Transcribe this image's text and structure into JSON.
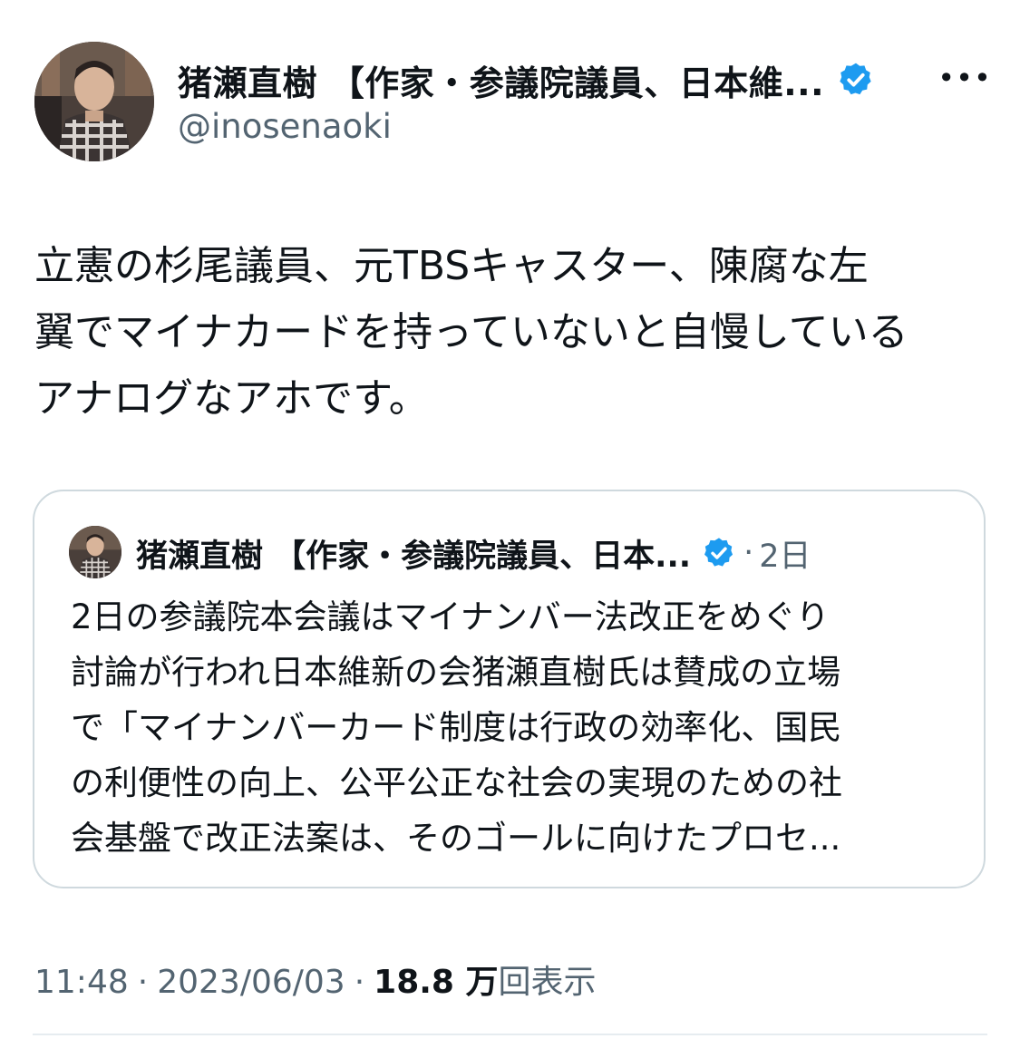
{
  "author": {
    "name": "猪瀬直樹 【作家・参議院議員、日本維...",
    "handle": "@inosenaoki",
    "verified_icon": "verified-badge-icon",
    "verified_color": "#1d9bf0"
  },
  "more_icon": "more-options-icon",
  "more_label": "•••",
  "tweet": {
    "text": "立憲の杉尾議員、元TBSキャスター、陳腐な左\n翼でマイナカードを持っていないと自慢している\nアナログなアホです。"
  },
  "quote": {
    "name": "猪瀬直樹 【作家・参議院議員、日本...",
    "dot": "·",
    "time": "2日",
    "text": "2日の参議院本会議はマイナンバー法改正をめぐり\n討論が行われ日本維新の会猪瀬直樹氏は賛成の立場\nで「マイナンバーカード制度は行政の効率化、国民\nの利便性の向上、公平公正な社会の実現のための社\n会基盤で改正法案は、そのゴールに向けたプロセ..."
  },
  "meta": {
    "time": "11:48",
    "sep": "·",
    "date": "2023/06/03",
    "views_count": "18.8 万",
    "views_label": "回表示"
  }
}
